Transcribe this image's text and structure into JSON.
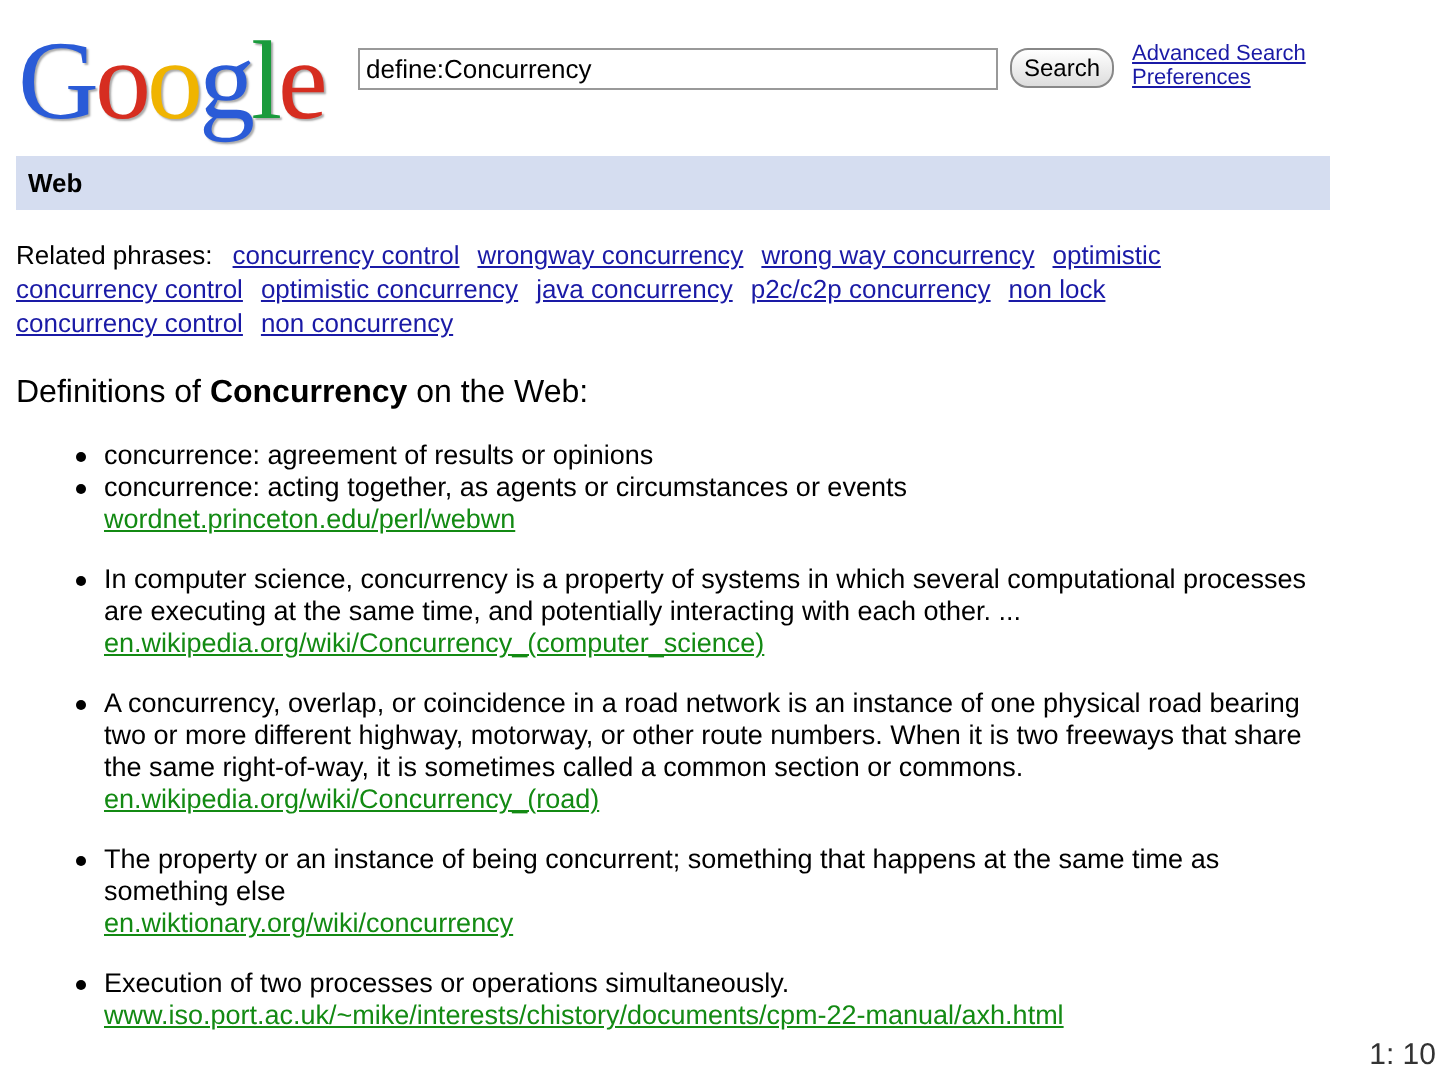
{
  "logo": "Google",
  "search": {
    "value": "define:Concurrency",
    "button": "Search"
  },
  "header_links": [
    "Advanced Search",
    "Preferences"
  ],
  "section_bar": "Web",
  "related": {
    "label": "Related phrases:",
    "lines": [
      [
        "concurrency control",
        "wrongway concurrency",
        "wrong way concurrency",
        "optimistic"
      ],
      [
        "concurrency control",
        "optimistic concurrency",
        "java concurrency",
        "p2c/c2p concurrency",
        "non lock"
      ],
      [
        "concurrency control",
        "non concurrency"
      ]
    ]
  },
  "heading": "Definitions of **Concurrency** on the Web:",
  "groups": [
    {
      "definitions": [
        "concurrence: agreement of results or opinions",
        "concurrence: acting together, as agents or circumstances or events"
      ],
      "source": "wordnet.princeton.edu/perl/webwn"
    },
    {
      "definitions": [
        "In computer science, concurrency is a property of systems in which several computational processes are executing at the same time, and potentially interacting with each other. ..."
      ],
      "source": "en.wikipedia.org/wiki/Concurrency_(computer_science)"
    },
    {
      "definitions": [
        "A concurrency, overlap, or coincidence in a road network is an instance of one physical road bearing two or more different highway, motorway, or other route numbers. When it is two freeways that share the same right-of-way, it is sometimes called a common section or commons."
      ],
      "source": "en.wikipedia.org/wiki/Concurrency_(road)"
    },
    {
      "definitions": [
        "The property or an instance of being concurrent; something that happens at the same time as something else"
      ],
      "source": "en.wiktionary.org/wiki/concurrency"
    },
    {
      "definitions": [
        "Execution of two processes or operations simultaneously."
      ],
      "source": "www.iso.port.ac.uk/~mike/interests/chistory/documents/cpm-22-manual/axh.html"
    }
  ],
  "slide_number": "1: 10"
}
